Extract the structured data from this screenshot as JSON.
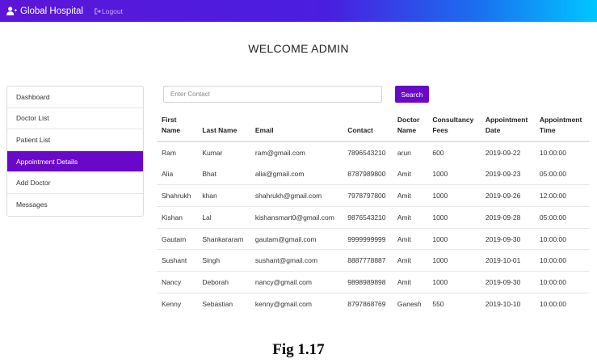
{
  "navbar": {
    "brand": "Global Hospital",
    "brand_icon": "user-plus-icon",
    "logout_label": "Logout",
    "logout_icon": "sign-out-icon"
  },
  "welcome": "WELCOME ADMIN",
  "sidebar": {
    "items": [
      {
        "label": "Dashboard",
        "active": false
      },
      {
        "label": "Doctor List",
        "active": false
      },
      {
        "label": "Patient List",
        "active": false
      },
      {
        "label": "Appointment Details",
        "active": true
      },
      {
        "label": "Add Doctor",
        "active": false
      },
      {
        "label": "Messages",
        "active": false
      }
    ]
  },
  "search": {
    "placeholder": "Enter Contact",
    "button_label": "Search"
  },
  "table": {
    "headers": [
      "First\nName",
      "Last Name",
      "Email",
      "Contact",
      "Doctor\nName",
      "Consultancy\nFees",
      "Appointment\nDate",
      "Appointment\nTime"
    ],
    "rows": [
      [
        "Ram",
        "Kumar",
        "ram@gmail.com",
        "7896543210",
        "arun",
        "600",
        "2019-09-22",
        "10:00:00"
      ],
      [
        "Alia",
        "Bhat",
        "alia@gmail.com",
        "8787989800",
        "Amit",
        "1000",
        "2019-09-23",
        "05:00:00"
      ],
      [
        "Shahrukh",
        "khan",
        "shahrukh@gmail.com",
        "7978797800",
        "Amit",
        "1000",
        "2019-09-26",
        "12:00:00"
      ],
      [
        "Kishan",
        "Lal",
        "kishansmart0@gmail.com",
        "9876543210",
        "Amit",
        "1000",
        "2019-09-28",
        "05:00:00"
      ],
      [
        "Gautam",
        "Shankararam",
        "gautam@gmail.com",
        "9999999999",
        "Amit",
        "1000",
        "2019-09-30",
        "10:00:00"
      ],
      [
        "Sushant",
        "Singh",
        "sushant@gmail.com",
        "8887778887",
        "Amit",
        "1000",
        "2019-10-01",
        "10:00:00"
      ],
      [
        "Nancy",
        "Deborah",
        "nancy@gmail.com",
        "9898989898",
        "Amit",
        "1000",
        "2019-09-30",
        "10:00:00"
      ],
      [
        "Kenny",
        "Sebastian",
        "kenny@gmail.com",
        "8797868769",
        "Ganesh",
        "550",
        "2019-10-10",
        "10:00:00"
      ]
    ]
  },
  "caption": "Fig 1.17",
  "colors": {
    "accent": "#6a08c9",
    "navbar_start": "#5b16d8",
    "navbar_end": "#00c6ff"
  }
}
